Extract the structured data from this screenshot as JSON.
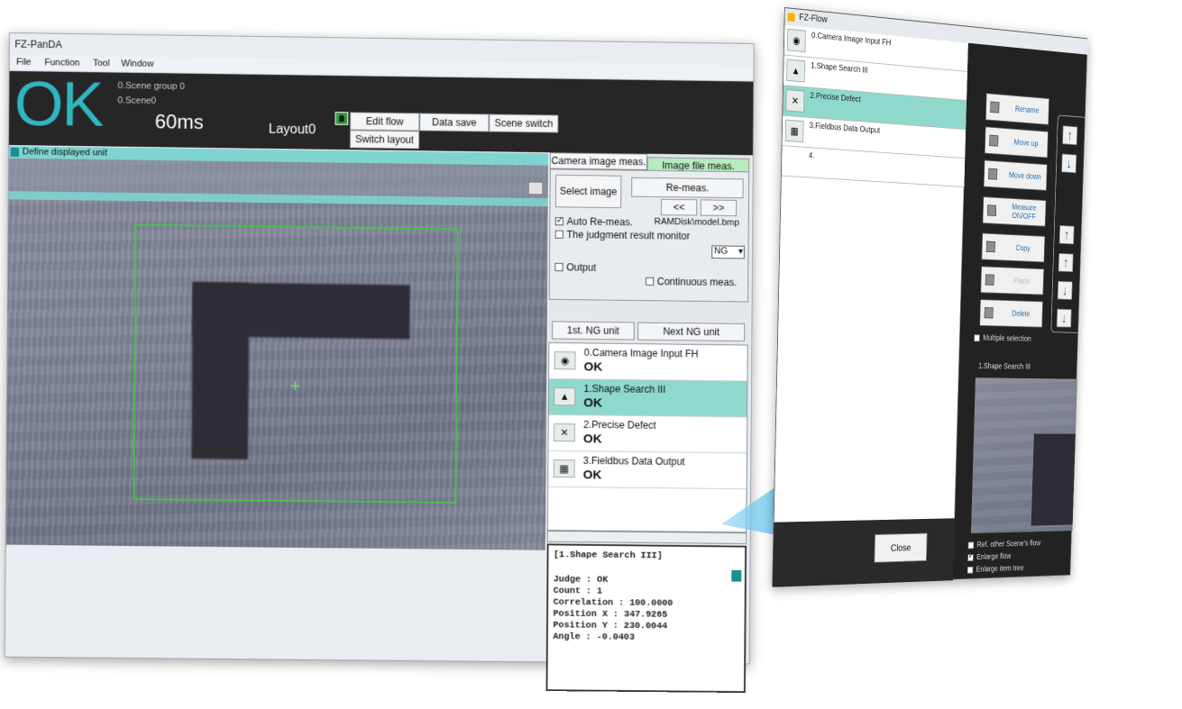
{
  "panda": {
    "title": "FZ-PanDA",
    "menu": [
      "File",
      "Function",
      "Tool",
      "Window"
    ],
    "judge_big": "OK",
    "scene_group": "0.Scene group 0",
    "scene": "0.Scene0",
    "time": "60ms",
    "layout": "Layout0",
    "buttons": {
      "edit_flow": "Edit flow",
      "data_save": "Data save",
      "scene_switch": "Scene switch",
      "switch_layout": "Switch layout"
    },
    "define_unit": "Define displayed unit",
    "tabs": [
      "Camera image meas.",
      "Image file meas."
    ],
    "select_image": "Select image",
    "re_meas": "Re-meas.",
    "prev": "<<",
    "next": ">>",
    "auto_remeas": "Auto Re-meas.",
    "auto_remeas_checked": true,
    "file_path": "RAMDisk\\model.bmp",
    "judgment_monitor": "The judgment result monitor",
    "judgment_checked": false,
    "monitor_value": "NG",
    "output": "Output",
    "output_checked": false,
    "continuous": "Continuous meas.",
    "continuous_checked": false,
    "first_ng": "1st. NG unit",
    "next_ng": "Next NG unit",
    "units": [
      {
        "name": "0.Camera Image Input FH",
        "status": "OK",
        "icon": "camera-icon"
      },
      {
        "name": "1.Shape Search III",
        "status": "OK",
        "icon": "shape-search-icon"
      },
      {
        "name": "2.Precise Defect",
        "status": "OK",
        "icon": "defect-icon"
      },
      {
        "name": "3.Fieldbus Data Output",
        "status": "OK",
        "icon": "fieldbus-icon"
      }
    ],
    "result": {
      "header": "[1.Shape Search III]",
      "lines": [
        "Judge : OK",
        "Count : 1",
        "Correlation : 100.0000",
        "Position X : 347.9265",
        "Position Y : 230.0044",
        "Angle : -0.0403"
      ]
    }
  },
  "flow": {
    "title": "FZ-Flow",
    "items": [
      {
        "name": "0.Camera Image Input FH",
        "icon": "camera-icon"
      },
      {
        "name": "1.Shape Search III",
        "icon": "shape-search-icon"
      },
      {
        "name": "2.Precise Defect",
        "icon": "defect-icon"
      },
      {
        "name": "3.Fieldbus Data Output",
        "icon": "fieldbus-icon"
      },
      {
        "name": "4.",
        "icon": ""
      }
    ],
    "buttons": {
      "rename": "Rename",
      "move_up": "Move up",
      "move_down": "Move down",
      "measure_onoff": "Measure ON/OFF",
      "copy": "Copy",
      "paste": "Paste",
      "delete": "Delete",
      "close": "Close"
    },
    "multiple_selection": "Multiple selection",
    "preview_label": "1.Shape Search III",
    "ref_other": "Ref. other Scene's flow",
    "enlarge_flow": "Enlarge flow",
    "enlarge_flow_checked": true,
    "enlarge_itemtree": "Enlarge item tree"
  },
  "colors": {
    "accent_teal": "#2fb7bf",
    "active_row": "#8fd8cc",
    "arrow_blue": "#2aa9e6"
  }
}
